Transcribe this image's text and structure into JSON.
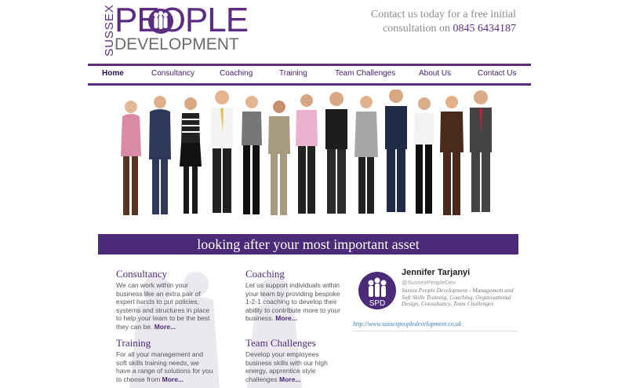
{
  "logo": {
    "sussex": "SUSSEX",
    "people": "PEOPLE",
    "development": "DEVELOPMENT"
  },
  "header": {
    "contact_line1": "Contact us today for a free initial",
    "contact_line2_prefix": "consultation on",
    "phone": "0845 6434187"
  },
  "nav": {
    "items": [
      {
        "label": "Home"
      },
      {
        "label": "Consultancy"
      },
      {
        "label": "Coaching"
      },
      {
        "label": "Training"
      },
      {
        "label": "Team Challenges"
      },
      {
        "label": "About Us"
      },
      {
        "label": "Contact Us"
      }
    ]
  },
  "banner": {
    "text": "looking after your most important asset"
  },
  "sections": {
    "consultancy": {
      "title": "Consultancy",
      "body": "We can work within your business like an extra pair of expert hands to put policies, systems and structures in place to help your team to be the best they can be.",
      "more": "More..."
    },
    "coaching": {
      "title": "Coaching",
      "body": "Let us support individuals within your team by providing bespoke 1-2-1 coaching to develop their ability to contribute more to your business.",
      "more": "More..."
    },
    "training": {
      "title": "Training",
      "body": "For all your management and soft skills training needs, we have a range of solutions for you to choose from",
      "more": "More..."
    },
    "team_challenges": {
      "title": "Team Challenges",
      "body": "Develop your employees business skills with our high energy, apprentice style challenges",
      "more": "More..."
    }
  },
  "twitter": {
    "name": "Jennifer Tarjanyi",
    "handle": "@SussexPeopleDev",
    "description": "Sussex People Development - Management and Soft Skills Training, Coaching, Organisational Design, Consultancy, Team Challenges",
    "avatar_text": "SPD",
    "link": "http://www.sussexpeopledevelopment.co.uk"
  },
  "colors": {
    "brand": "#5b2d82",
    "banner": "#4b2b78",
    "link": "#3a7bc8"
  }
}
